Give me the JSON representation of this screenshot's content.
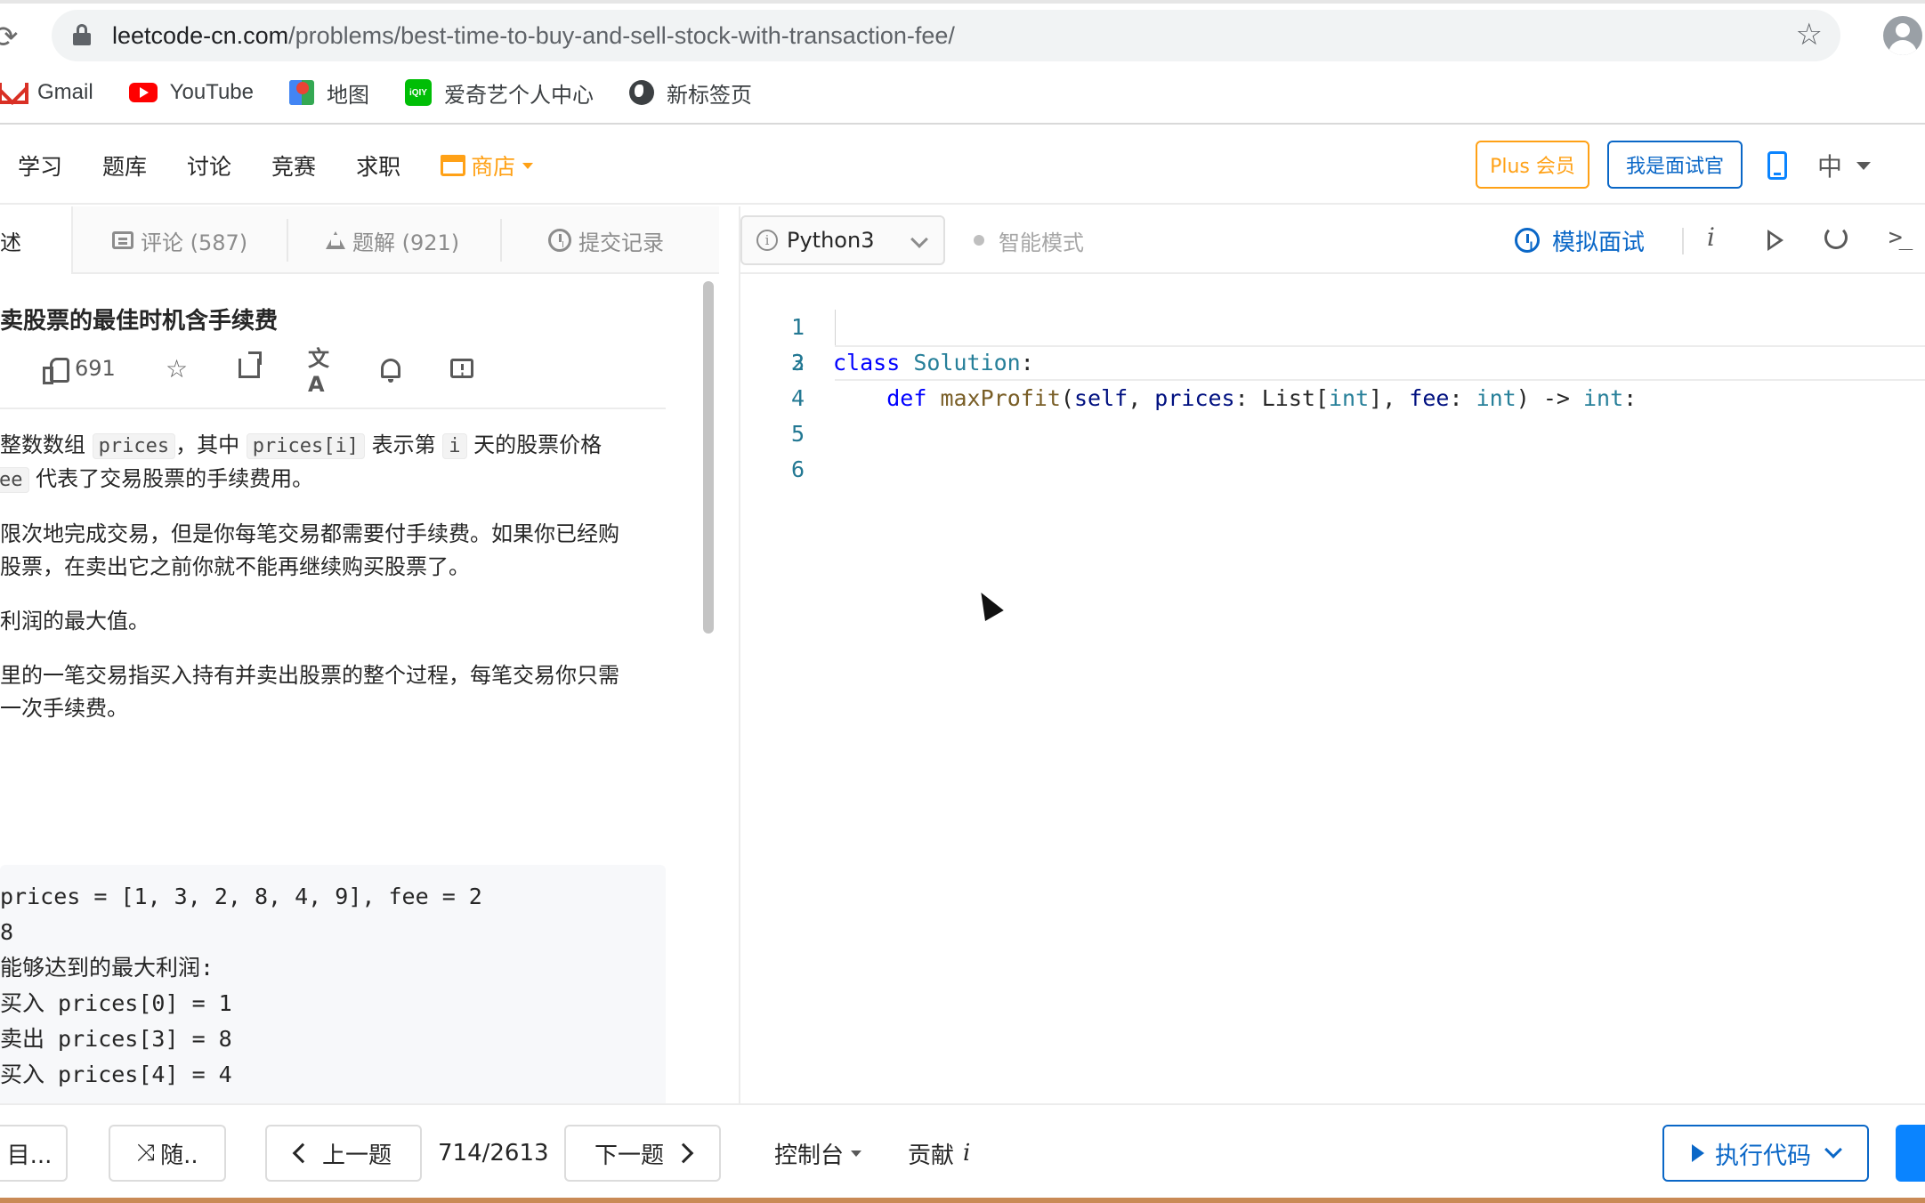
{
  "browser": {
    "url_host": "leetcode-cn.com",
    "url_path": "/problems/best-time-to-buy-and-sell-stock-with-transaction-fee/",
    "bookmarks": [
      {
        "label": "Gmail",
        "icon": "gmail-icon"
      },
      {
        "label": "YouTube",
        "icon": "youtube-icon"
      },
      {
        "label": "地图",
        "icon": "maps-icon"
      },
      {
        "label": "爱奇艺个人中心",
        "icon": "iqiyi-icon"
      },
      {
        "label": "新标签页",
        "icon": "globe-icon"
      }
    ],
    "iqiyi_icon_text": "iQIY"
  },
  "site_nav": {
    "items": [
      "学习",
      "题库",
      "讨论",
      "竞赛",
      "求职"
    ],
    "store": "商店",
    "plus": "Plus 会员",
    "interviewer": "我是面试官",
    "language": "中"
  },
  "left_tabs": {
    "description": "述",
    "comments": "评论 (587)",
    "solutions": "题解 (921)",
    "submissions": "提交记录"
  },
  "problem": {
    "title": "卖股票的最佳时机含手续费",
    "likes": "691",
    "description": {
      "p1_a": "整数数组",
      "p1_code1": "prices",
      "p1_b": "，其中",
      "p1_code2": "prices[i]",
      "p1_c": "表示第",
      "p1_code3": "i",
      "p1_d": "天的股票价格",
      "p1_code4": "ee",
      "p1_e": "代表了交易股票的手续费用。",
      "p2_line1": "限次地完成交易，但是你每笔交易都需要付手续费。如果你已经购",
      "p2_line2": "股票，在卖出它之前你就不能再继续购买股票了。",
      "p3": "利润的最大值。",
      "p4_line1": "里的一笔交易指买入持有并卖出股票的整个过程，每笔交易你只需",
      "p4_line2": "一次手续费。"
    },
    "example_lines": [
      "prices = [1, 3, 2, 8, 4, 9], fee = 2",
      "8",
      "能够达到的最大利润:",
      "买入 prices[0] = 1",
      "卖出 prices[3] = 8",
      "买入 prices[4] = 4"
    ]
  },
  "editor": {
    "language": "Python3",
    "smart_mode": "智能模式",
    "mock_interview": "模拟面试",
    "info_label": "i",
    "line_numbers": [
      "1",
      "2",
      "3",
      "4",
      "5",
      "6"
    ],
    "code": {
      "l1_kw": "class",
      "l1_cls": "Solution",
      "l1_colon": ":",
      "l2_kw": "def",
      "l2_fn": "maxProfit",
      "l2_open": "(",
      "l2_self": "self",
      "l2_comma1": ", ",
      "l2_prices": "prices",
      "l2_colon1": ": ",
      "l2_list": "List[",
      "l2_int1": "int",
      "l2_close_br": "], ",
      "l2_fee": "fee",
      "l2_colon2": ": ",
      "l2_int2": "int",
      "l2_arrow": ") -> ",
      "l2_int3": "int",
      "l2_colon3": ":"
    }
  },
  "footer": {
    "list": "目...",
    "random": "随..",
    "prev": "上一题",
    "count": "714/2613",
    "next": "下一题",
    "console": "控制台",
    "contribute": "贡献",
    "contribute_i": "i",
    "run": "执行代码"
  },
  "colors": {
    "accent_orange": "#ffa116",
    "accent_blue": "#0a67c7"
  }
}
